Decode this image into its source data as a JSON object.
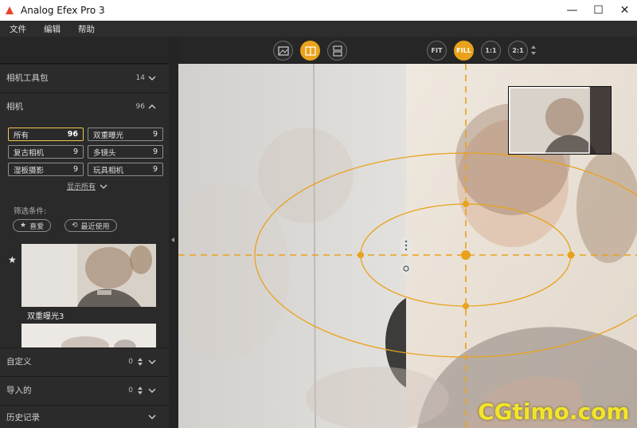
{
  "app": {
    "title": "Analog Efex Pro 3"
  },
  "window_controls": {
    "minimize": "—",
    "maximize": "☐",
    "close": "✕"
  },
  "menu": [
    "文件",
    "编辑",
    "帮助"
  ],
  "left_panel": {
    "sections": [
      {
        "title": "相机工具包",
        "count": "14",
        "expanded": false
      },
      {
        "title": "相机",
        "count": "96",
        "expanded": true
      }
    ],
    "categories": [
      {
        "label": "所有",
        "count": "96",
        "selected": true
      },
      {
        "label": "双重曝光",
        "count": "9",
        "selected": false
      },
      {
        "label": "复古相机",
        "count": "9",
        "selected": false
      },
      {
        "label": "多镜头",
        "count": "9",
        "selected": false
      },
      {
        "label": "湿板摄影",
        "count": "9",
        "selected": false
      },
      {
        "label": "玩具相机",
        "count": "9",
        "selected": false
      }
    ],
    "show_all": "显示所有",
    "filter_label": "筛选条件:",
    "filters": [
      "喜爱",
      "最近使用"
    ],
    "preset_thumbnail_label": "双重曝光3",
    "bottom_sections": [
      {
        "title": "自定义",
        "count": "0"
      },
      {
        "title": "导入的",
        "count": "0"
      },
      {
        "title": "历史记录",
        "count": ""
      }
    ]
  },
  "toolbar": {
    "view_buttons": [
      "single-view",
      "split-view",
      "side-by-side-view"
    ],
    "zoom_buttons": [
      "FIT",
      "FILL",
      "1:1",
      "2:1"
    ],
    "active_zoom": "FILL"
  },
  "overlay": {
    "accent_color": "#e9a21c"
  },
  "watermark": "CGtimo.com"
}
